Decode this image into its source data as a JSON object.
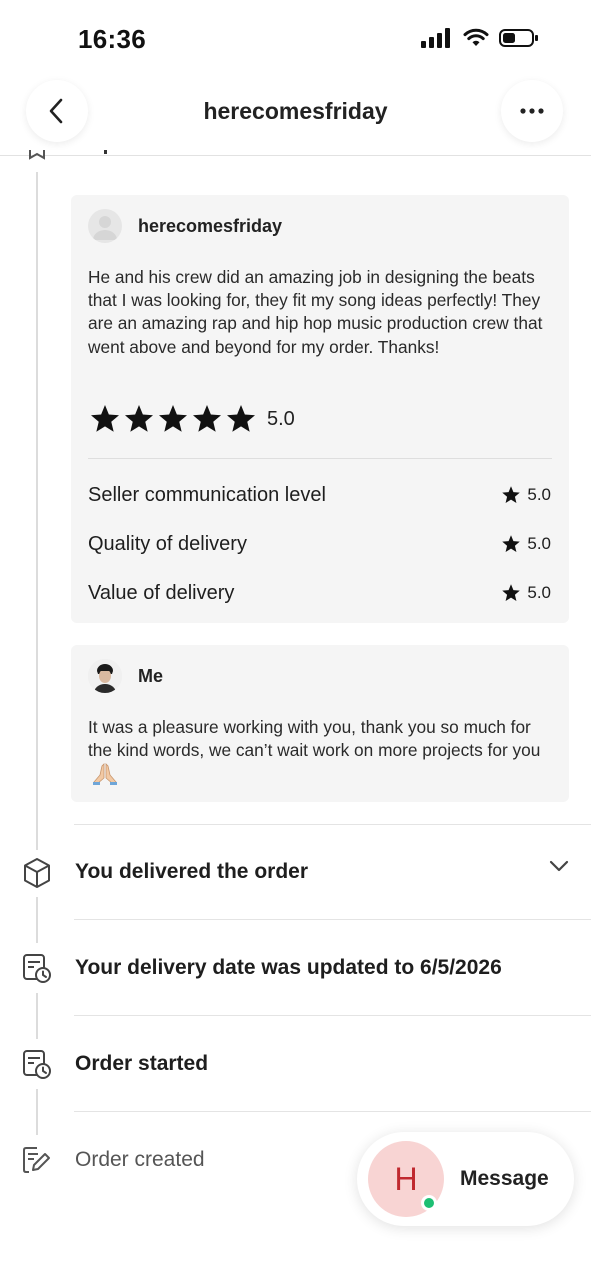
{
  "status_bar": {
    "time": "16:36"
  },
  "header": {
    "title": "herecomesfriday"
  },
  "review": {
    "reviewer_name": "herecomesfriday",
    "text": "He and his crew did an amazing job in designing the beats that I was looking for, they fit my song ideas perfectly! They are an amazing rap and hip hop music production crew that went above and beyond for my order. Thanks!",
    "overall_score": "5.0",
    "stars": 5,
    "ratings": [
      {
        "label": "Seller communication level",
        "value": "5.0"
      },
      {
        "label": "Quality of delivery",
        "value": "5.0"
      },
      {
        "label": "Value of delivery",
        "value": "5.0"
      }
    ]
  },
  "reply": {
    "author": "Me",
    "text": "It was a pleasure working with you, thank you so much for the kind words, we can’t wait work on more projects for you"
  },
  "activity": [
    {
      "label": "You delivered the order",
      "icon": "package-icon"
    },
    {
      "label": "Your delivery date was updated to 6/5/2026",
      "icon": "calendar-clock-icon"
    },
    {
      "label": "Order started",
      "icon": "calendar-clock-icon"
    },
    {
      "label": "Order created",
      "icon": "edit-document-icon"
    }
  ],
  "message_button": {
    "avatar_letter": "H",
    "label": "Message"
  },
  "colors": {
    "online": "#1dbf73",
    "avatar_bg": "#f8d4d3",
    "avatar_text": "#c0292f",
    "card_bg": "#f5f5f5"
  }
}
